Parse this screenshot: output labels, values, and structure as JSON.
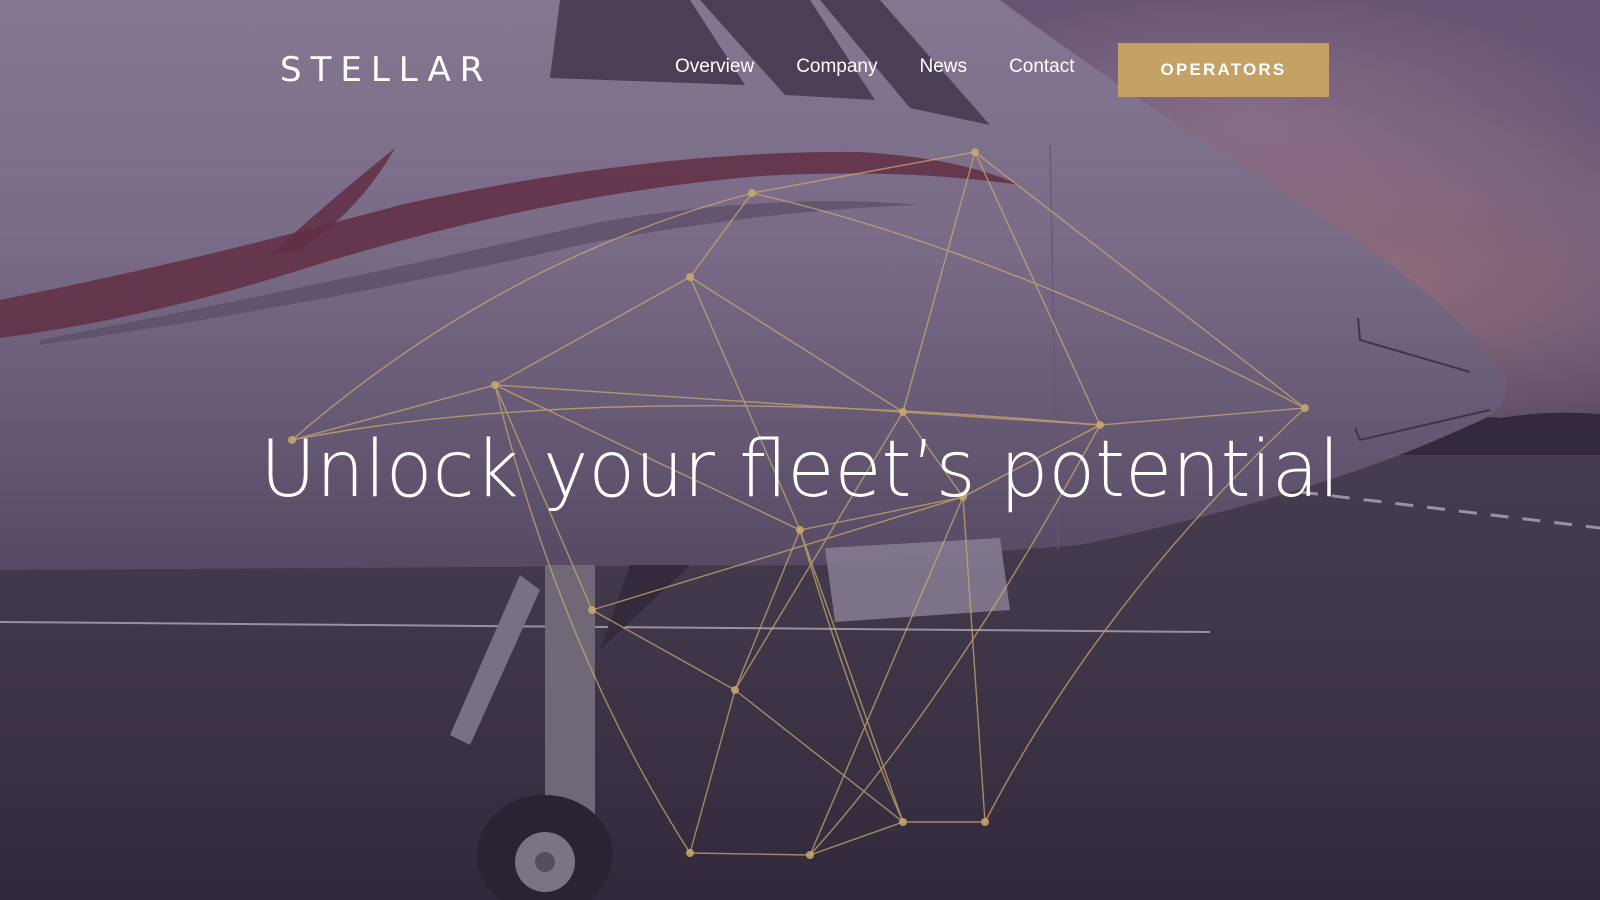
{
  "brand": {
    "logo_text": "STELLAR"
  },
  "nav": {
    "items": [
      {
        "label": "Overview"
      },
      {
        "label": "Company"
      },
      {
        "label": "News"
      },
      {
        "label": "Contact"
      }
    ]
  },
  "cta": {
    "label": "OPERATORS"
  },
  "hero": {
    "headline": "Unlock your fleet’s potential"
  },
  "colors": {
    "accent_gold": "#c4a165",
    "text": "#ffffff",
    "overlay_purple": "#6f5f7a"
  }
}
